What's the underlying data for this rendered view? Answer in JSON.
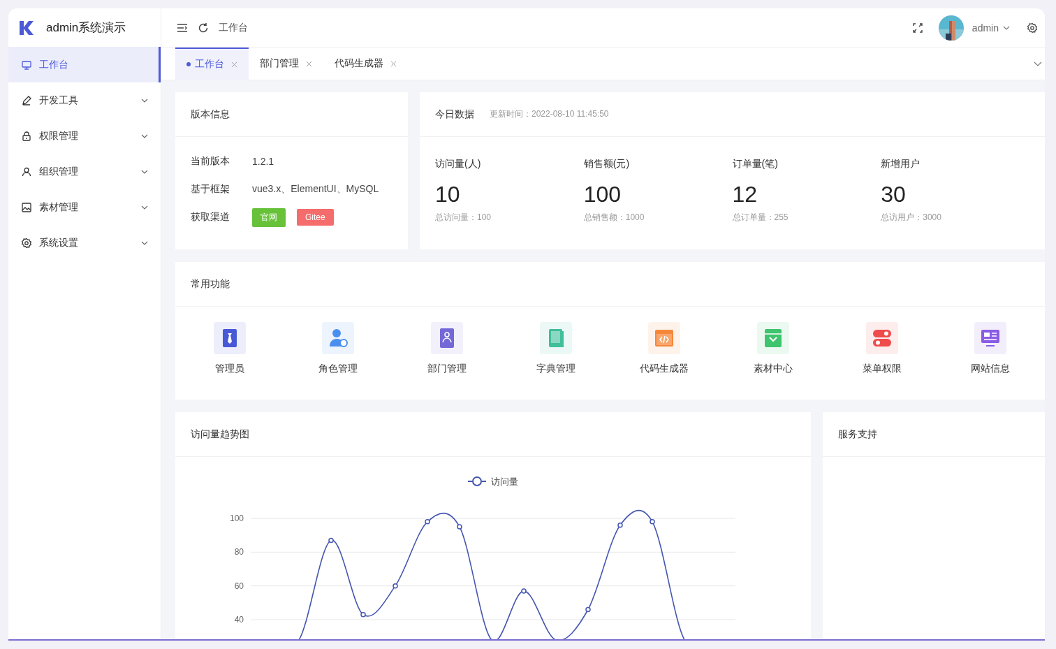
{
  "app": {
    "name": "admin系统演示"
  },
  "sidebar": {
    "items": [
      {
        "label": "工作台",
        "kind": "link",
        "selected": true
      },
      {
        "label": "开发工具",
        "kind": "group",
        "selected": false,
        "expanded": false
      },
      {
        "label": "权限管理",
        "kind": "group",
        "selected": false,
        "expanded": false
      },
      {
        "label": "组织管理",
        "kind": "group",
        "selected": false,
        "expanded": false
      },
      {
        "label": "素材管理",
        "kind": "group",
        "selected": false,
        "expanded": false
      },
      {
        "label": "系统设置",
        "kind": "group",
        "selected": false,
        "expanded": false
      }
    ]
  },
  "header": {
    "breadcrumb": "工作台",
    "user": "admin"
  },
  "tabs": [
    {
      "label": "工作台",
      "selected": true
    },
    {
      "label": "部门管理",
      "selected": false
    },
    {
      "label": "代码生成器",
      "selected": false
    }
  ],
  "version_card": {
    "title": "版本信息",
    "rows": [
      {
        "label": "当前版本",
        "kind": "text",
        "value": "1.2.1"
      },
      {
        "label": "基于框架",
        "kind": "text",
        "value": "vue3.x、ElementUI、MySQL"
      },
      {
        "label": "获取渠道",
        "kind": "tags",
        "tags": [
          {
            "label": "官网",
            "color": "#67c23a"
          },
          {
            "label": "Gitee",
            "color": "#f56c6c"
          }
        ]
      }
    ]
  },
  "today_card": {
    "title": "今日数据",
    "updated": "更新时间：2022-08-10 11:45:50",
    "stats": [
      {
        "label": "访问量(人)",
        "value": "10",
        "total": "总访问量：100"
      },
      {
        "label": "销售额(元)",
        "value": "100",
        "total": "总销售额：1000"
      },
      {
        "label": "订单量(笔)",
        "value": "12",
        "total": "总订单量：255"
      },
      {
        "label": "新增用户",
        "value": "30",
        "total": "总访用户：3000"
      }
    ]
  },
  "shortcuts": {
    "title": "常用功能",
    "items": [
      {
        "label": "管理员",
        "color": "#4759d6"
      },
      {
        "label": "角色管理",
        "color": "#4a8ff0"
      },
      {
        "label": "部门管理",
        "color": "#7468d8"
      },
      {
        "label": "字典管理",
        "color": "#3fbf9a"
      },
      {
        "label": "代码生成器",
        "color": "#f5873a"
      },
      {
        "label": "素材中心",
        "color": "#3ec46d"
      },
      {
        "label": "菜单权限",
        "color": "#f04b4b"
      },
      {
        "label": "网站信息",
        "color": "#8a5ce6"
      }
    ]
  },
  "trend_card": {
    "title": "访问量趋势图",
    "chart_data": {
      "type": "line",
      "ylim": [
        40,
        100
      ],
      "yticks": [
        40,
        60,
        80,
        100
      ],
      "grid": true,
      "series": [
        {
          "name": "访问量",
          "color": "#4556b0",
          "marker": "circle",
          "values": [
            null,
            null,
            87,
            43,
            60,
            98,
            95,
            null,
            57,
            null,
            46,
            96,
            98,
            null,
            null
          ]
        }
      ]
    }
  },
  "service_card": {
    "title": "服务支持"
  }
}
